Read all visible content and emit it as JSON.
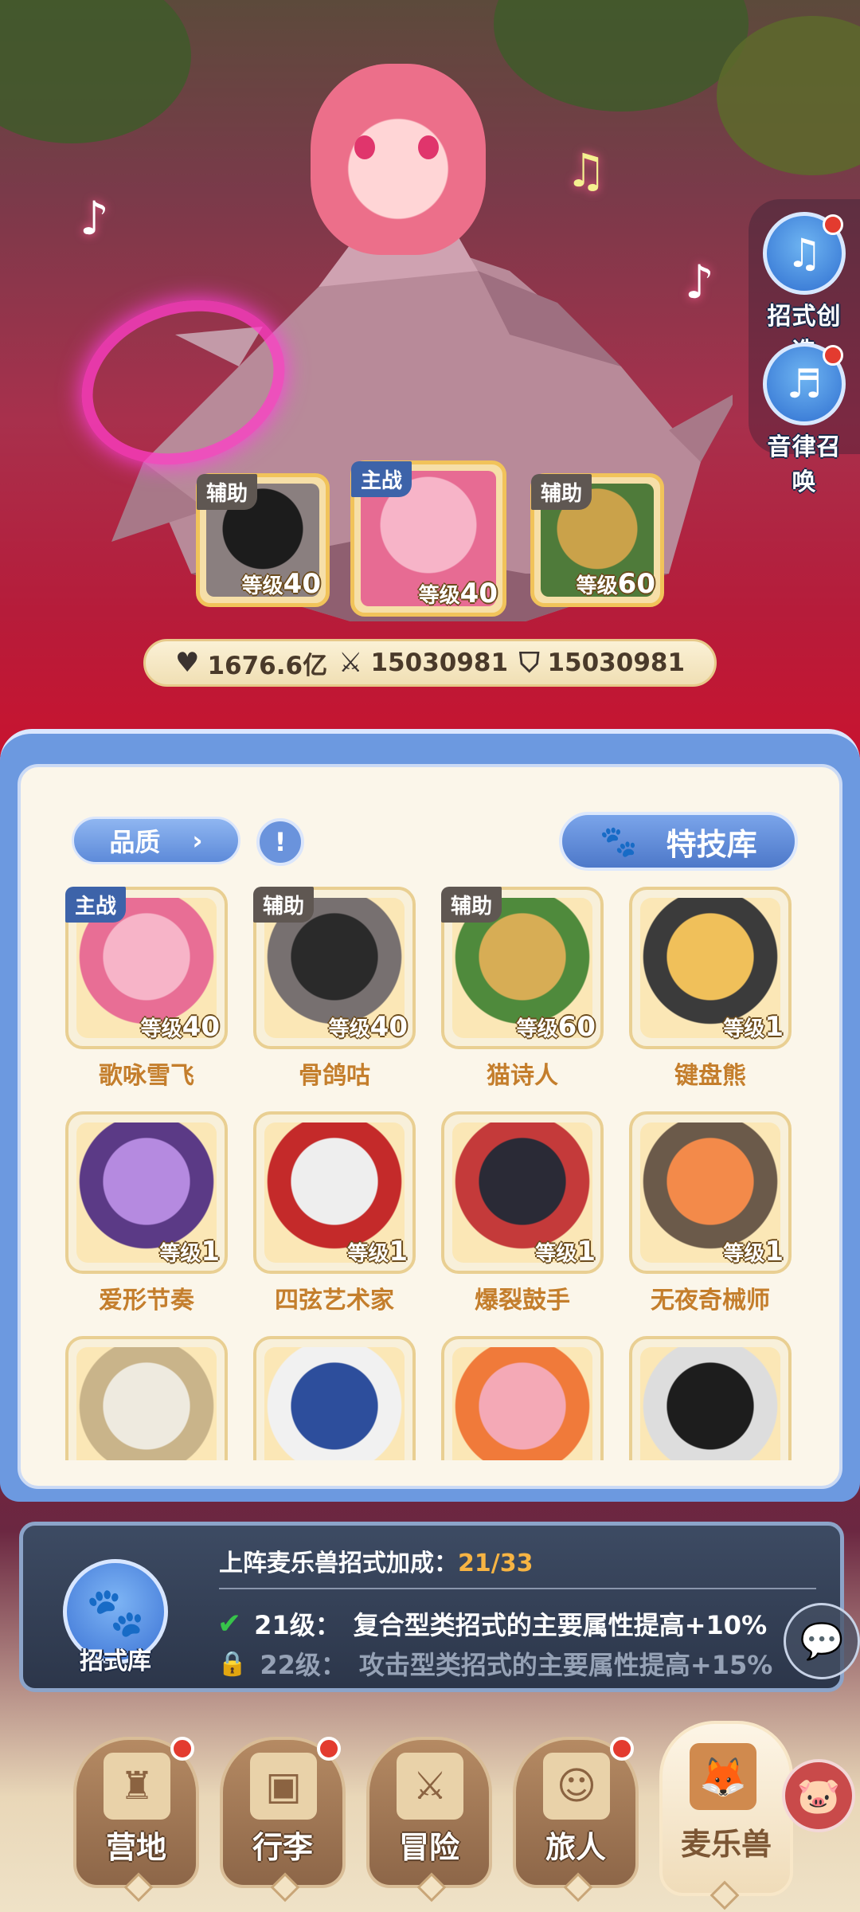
{
  "side_buttons": [
    {
      "label": "招式创造",
      "icon": "music-create-icon",
      "badge": true
    },
    {
      "label": "音律召唤",
      "icon": "lyre-summon-icon",
      "badge": true
    }
  ],
  "team": [
    {
      "role": "辅助",
      "level_prefix": "等级",
      "level": "40",
      "colors": [
        "#1c1c1c",
        "#8a7f7f"
      ]
    },
    {
      "role": "主战",
      "level_prefix": "等级",
      "level": "40",
      "colors": [
        "#f7b4c8",
        "#e76b93"
      ]
    },
    {
      "role": "辅助",
      "level_prefix": "等级",
      "level": "60",
      "colors": [
        "#caa24a",
        "#4f7b3a"
      ]
    }
  ],
  "stats": {
    "hp": "1676.6亿",
    "attack": "15030981",
    "defense": "15030981"
  },
  "panel": {
    "quality_label": "品质",
    "filter_label": "!",
    "skill_library_label": "特技库"
  },
  "monsters": [
    {
      "name": "歌咏雪飞",
      "role": "主战",
      "level_prefix": "等级",
      "level": "40",
      "colors": [
        "#f7b4c8",
        "#e86e95"
      ]
    },
    {
      "name": "骨鸽咕",
      "role": "辅助",
      "level_prefix": "等级",
      "level": "40",
      "colors": [
        "#2a2a2a",
        "#777070"
      ]
    },
    {
      "name": "猫诗人",
      "role": "辅助",
      "level_prefix": "等级",
      "level": "60",
      "colors": [
        "#d7ad55",
        "#4f8a3c"
      ]
    },
    {
      "name": "键盘熊",
      "role": "",
      "level_prefix": "等级",
      "level": "1",
      "colors": [
        "#f0c05a",
        "#3b3b3b"
      ]
    },
    {
      "name": "爱形节奏",
      "role": "",
      "level_prefix": "等级",
      "level": "1",
      "colors": [
        "#b58ae0",
        "#5b3a86"
      ]
    },
    {
      "name": "四弦艺术家",
      "role": "",
      "level_prefix": "等级",
      "level": "1",
      "colors": [
        "#eeeeee",
        "#c42a2a"
      ]
    },
    {
      "name": "爆裂鼓手",
      "role": "",
      "level_prefix": "等级",
      "level": "1",
      "colors": [
        "#2a2a36",
        "#c43a3a"
      ]
    },
    {
      "name": "无夜奇械师",
      "role": "",
      "level_prefix": "等级",
      "level": "1",
      "colors": [
        "#f38a4a",
        "#6b5a4a"
      ]
    },
    {
      "name": "",
      "role": "",
      "level_prefix": "",
      "level": "",
      "colors": [
        "#eeeadf",
        "#c9b48a"
      ]
    },
    {
      "name": "",
      "role": "",
      "level_prefix": "",
      "level": "",
      "colors": [
        "#2d4e9c",
        "#f1f1f1"
      ]
    },
    {
      "name": "",
      "role": "",
      "level_prefix": "",
      "level": "",
      "colors": [
        "#f4a9b6",
        "#f07a3a"
      ]
    },
    {
      "name": "",
      "role": "",
      "level_prefix": "",
      "level": "",
      "colors": [
        "#1d1d1d",
        "#dddddd"
      ]
    }
  ],
  "bonus": {
    "icon_label": "招式库",
    "title": "上阵麦乐兽招式加成：",
    "progress": "21/33",
    "rows": [
      {
        "level": "21级：",
        "text": "复合型类招式的主要属性提高+10%",
        "unlocked": true
      },
      {
        "level": "22级：",
        "text": "攻击型类招式的主要属性提高+15%",
        "unlocked": false
      }
    ]
  },
  "nav": [
    {
      "label": "营地",
      "icon": "castle-icon",
      "badge": true,
      "active": false
    },
    {
      "label": "行李",
      "icon": "backpack-icon",
      "badge": true,
      "active": false
    },
    {
      "label": "冒险",
      "icon": "crossed-swords-icon",
      "badge": false,
      "active": false
    },
    {
      "label": "旅人",
      "icon": "traveler-icon",
      "badge": true,
      "active": false
    },
    {
      "label": "麦乐兽",
      "icon": "fox-icon",
      "badge": false,
      "active": true
    }
  ]
}
